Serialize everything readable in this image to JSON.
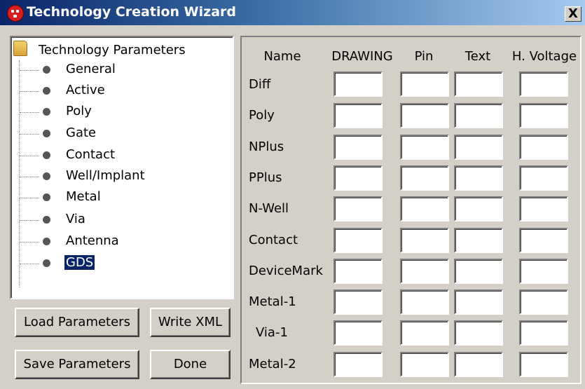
{
  "window": {
    "title": "Technology Creation Wizard",
    "close_label": "X"
  },
  "tree": {
    "root_label": "Technology Parameters",
    "items": [
      {
        "label": "General"
      },
      {
        "label": "Active"
      },
      {
        "label": "Poly"
      },
      {
        "label": "Gate"
      },
      {
        "label": "Contact"
      },
      {
        "label": "Well/Implant"
      },
      {
        "label": "Metal"
      },
      {
        "label": "Via"
      },
      {
        "label": "Antenna"
      },
      {
        "label": "GDS",
        "selected": true
      }
    ]
  },
  "buttons": {
    "load": "Load Parameters",
    "write": "Write XML",
    "save": "Save Parameters",
    "done": "Done"
  },
  "table": {
    "columns": [
      "Name",
      "DRAWING",
      "Pin",
      "Text",
      "H. Voltage"
    ],
    "rows": [
      {
        "name": "Diff",
        "values": [
          "",
          "",
          "",
          ""
        ]
      },
      {
        "name": "Poly",
        "values": [
          "",
          "",
          "",
          ""
        ]
      },
      {
        "name": "NPlus",
        "values": [
          "",
          "",
          "",
          ""
        ]
      },
      {
        "name": "PPlus",
        "values": [
          "",
          "",
          "",
          ""
        ]
      },
      {
        "name": "N-Well",
        "values": [
          "",
          "",
          "",
          ""
        ]
      },
      {
        "name": "Contact",
        "values": [
          "",
          "",
          "",
          ""
        ]
      },
      {
        "name": "DeviceMark",
        "values": [
          "",
          "",
          "",
          ""
        ]
      },
      {
        "name": "Metal-1",
        "values": [
          "",
          "",
          "",
          ""
        ]
      },
      {
        "name": "Via-1",
        "values": [
          "",
          "",
          "",
          ""
        ]
      },
      {
        "name": "Metal-2",
        "values": [
          "",
          "",
          "",
          ""
        ]
      }
    ]
  },
  "icons": {
    "app": "app-icon",
    "folder": "folder-icon",
    "bullet": "bullet-icon",
    "close": "close-icon"
  },
  "colors": {
    "titlebar_start": "#0a246a",
    "titlebar_end": "#a6caf0",
    "selection": "#0a246a",
    "face": "#d4d0c8"
  }
}
